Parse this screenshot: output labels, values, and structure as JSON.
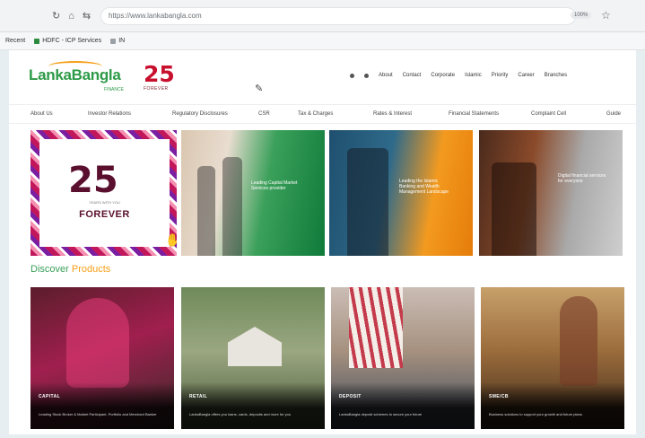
{
  "browser": {
    "url": "https://www.lankabangla.com",
    "zoom": "100%",
    "bookmarks": [
      "Recent",
      "HDFC - ICP Services",
      "IN"
    ]
  },
  "header": {
    "logo_text": "LankaBangla",
    "logo_sub": "FINANCE",
    "badge_number": "25",
    "badge_sub": "FOREVER",
    "utility_links": [
      "About",
      "Contact",
      "Corporate",
      "Islamic",
      "Priority",
      "Career",
      "Branches"
    ]
  },
  "main_nav": [
    "About Us",
    "Investor Relations",
    "Regulatory Disclosures",
    "CSR",
    "Tax & Charges",
    "Rates & Interest",
    "Financial Statements",
    "Complaint Cell",
    "Guide"
  ],
  "hero": {
    "slide1_number": "25",
    "slide1_small": "YEARS WITH YOU",
    "slide1_word": "FOREVER",
    "slide2_text": "Leading Capital Market Services provider",
    "slide3_text": "Leading the Islamic Banking and Wealth Management Landscape",
    "slide4_text": "Digital financial services for everyone"
  },
  "discover": {
    "title": "Discover",
    "accent": "Products"
  },
  "cards": [
    {
      "title": "CAPITAL",
      "desc": "Leading Stock Broker & Market Participant, Portfolio and Merchant Banker"
    },
    {
      "title": "RETAIL",
      "desc": "LankaBangla offers you loans, cards, deposits and more for you"
    },
    {
      "title": "DEPOSIT",
      "desc": "LankaBangla deposit schemes to secure your future"
    },
    {
      "title": "SME/CB",
      "desc": "Business solutions to support your growth and future plans"
    }
  ]
}
